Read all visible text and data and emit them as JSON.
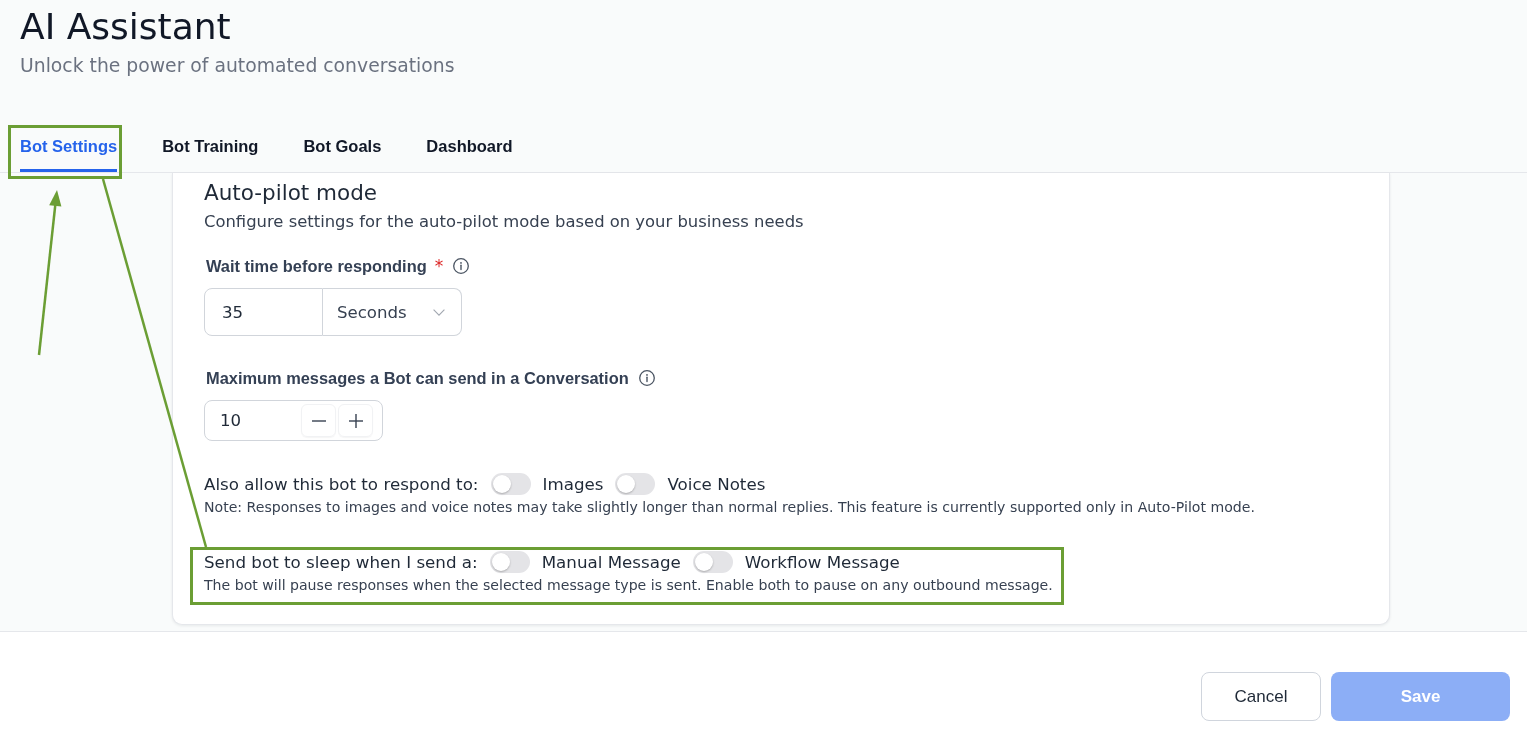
{
  "header": {
    "title": "AI Assistant",
    "subtitle": "Unlock the power of automated conversations"
  },
  "tabs": [
    {
      "label": "Bot Settings",
      "selected": true
    },
    {
      "label": "Bot Training",
      "selected": false
    },
    {
      "label": "Bot Goals",
      "selected": false
    },
    {
      "label": "Dashboard",
      "selected": false
    }
  ],
  "card": {
    "title": "Auto-pilot mode",
    "description": "Configure settings for the auto-pilot mode based on your business needs",
    "wait_time": {
      "label": "Wait time before responding",
      "required_mark": "*",
      "value": "35",
      "unit": "Seconds"
    },
    "max_messages": {
      "label": "Maximum messages a Bot can send in a Conversation",
      "value": "10"
    },
    "respond_to": {
      "label": "Also allow this bot to respond to:",
      "options": [
        {
          "label": "Images",
          "on": false
        },
        {
          "label": "Voice Notes",
          "on": false
        }
      ],
      "note": "Note: Responses to images and voice notes may take slightly longer than normal replies. This feature is currently supported only in Auto-Pilot mode."
    },
    "sleep": {
      "label": "Send bot to sleep when I send a:",
      "options": [
        {
          "label": "Manual Message",
          "on": false
        },
        {
          "label": "Workflow Message",
          "on": false
        }
      ],
      "note": "The bot will pause responses when the selected message type is sent. Enable both to pause on any outbound message."
    }
  },
  "footer": {
    "buttons": [
      {
        "label": "Cancel",
        "kind": "secondary",
        "disabled": false
      },
      {
        "label": "Save",
        "kind": "primary",
        "disabled": true
      }
    ]
  }
}
